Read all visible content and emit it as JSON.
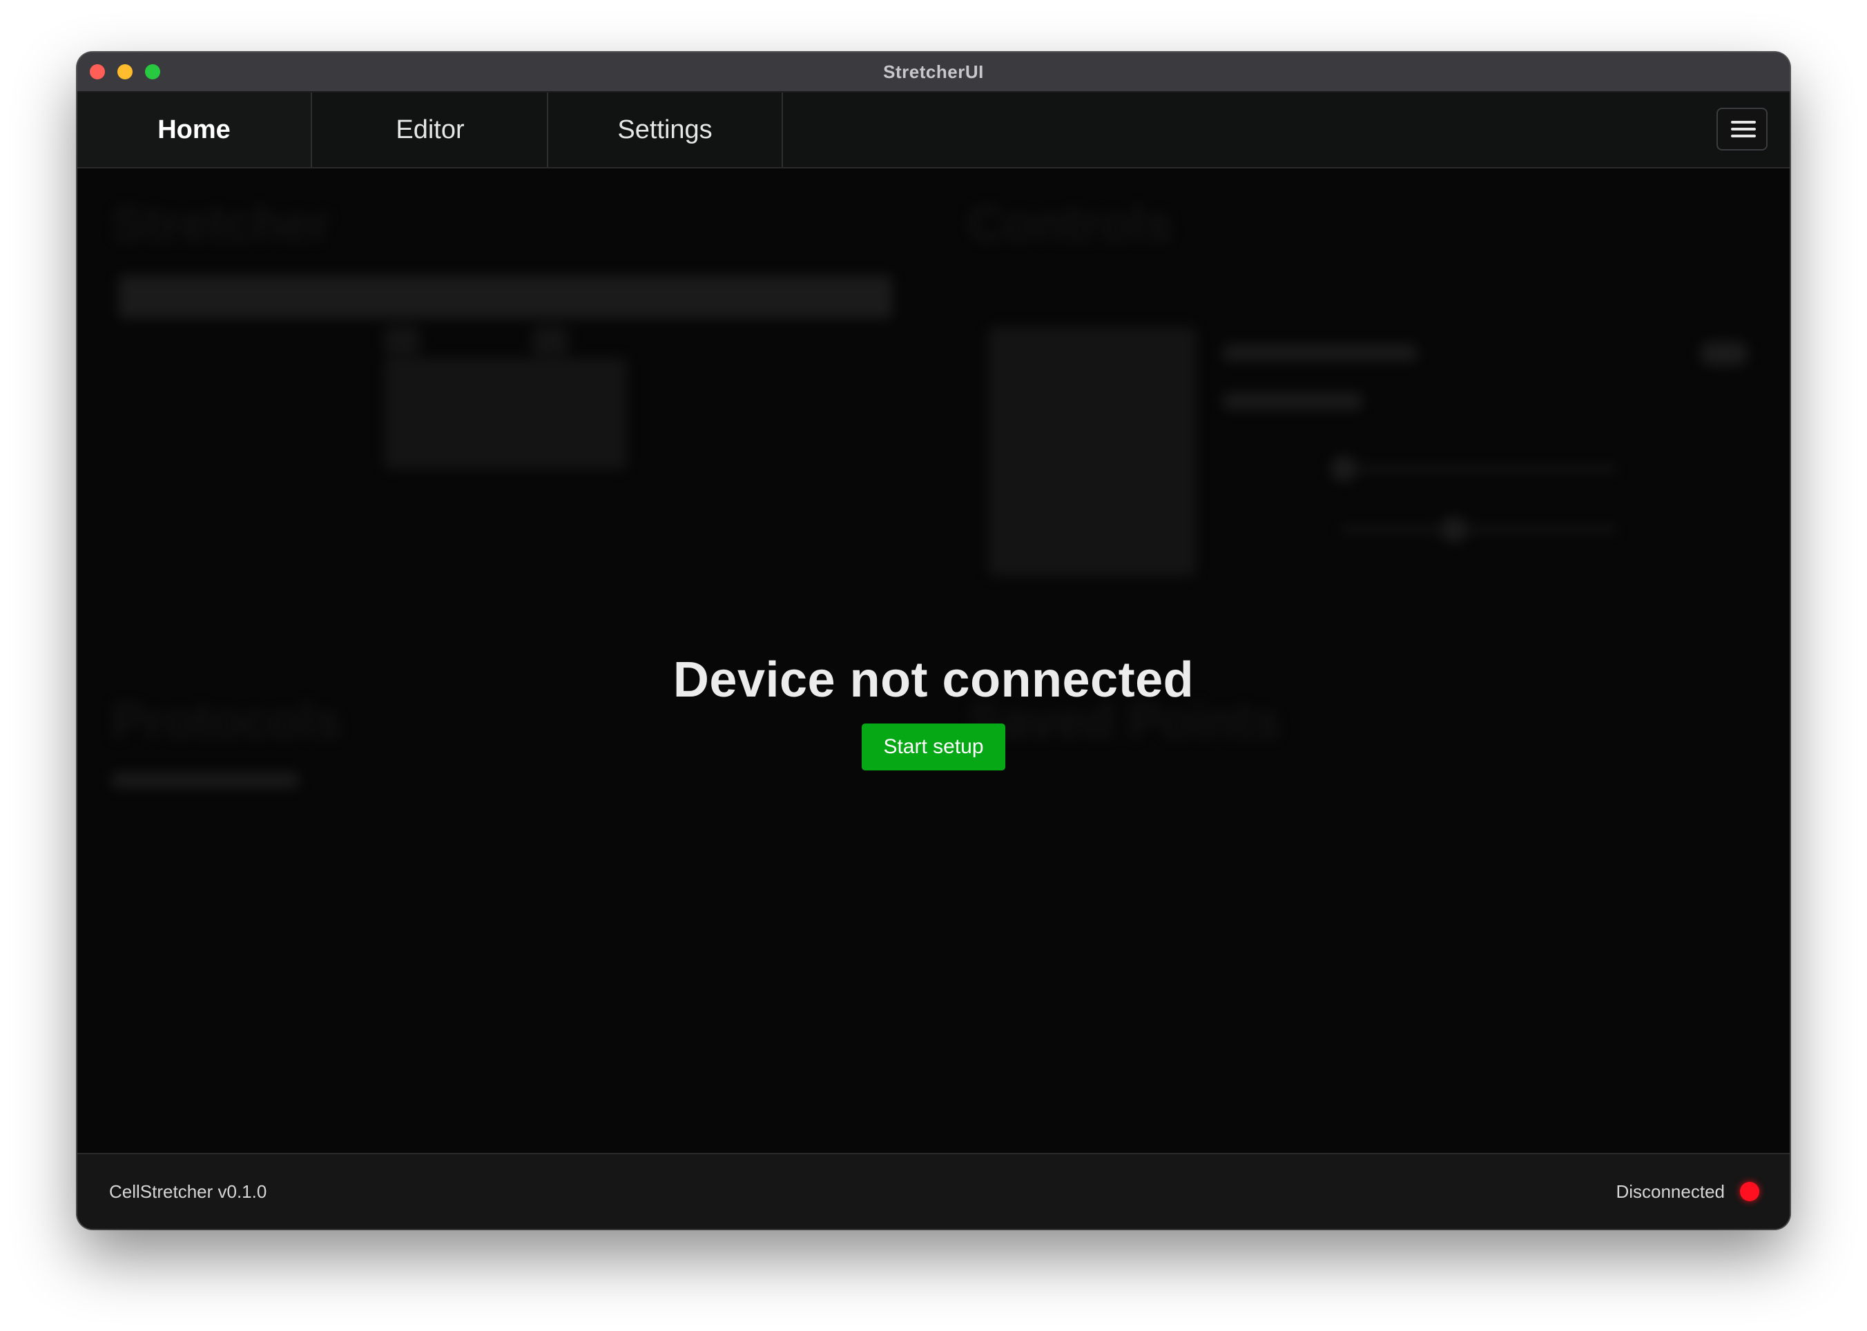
{
  "window": {
    "title": "StretcherUI"
  },
  "tabs": [
    {
      "label": "Home",
      "active": true
    },
    {
      "label": "Editor",
      "active": false
    },
    {
      "label": "Settings",
      "active": false
    }
  ],
  "menu": {
    "icon": "hamburger-menu-icon"
  },
  "background_panels": {
    "stretcher_heading": "Stretcher",
    "controls_heading": "Controls",
    "protocols_heading": "Protocols",
    "saved_points_heading": "Saved Points"
  },
  "overlay": {
    "title": "Device not connected",
    "setup_button": "Start setup"
  },
  "status": {
    "version": "CellStretcher v0.1.0",
    "connection": "Disconnected",
    "connection_color": "#ff1020"
  },
  "colors": {
    "accent": "#07a816",
    "background": "#070707",
    "titlebar": "#3b3b3f"
  }
}
